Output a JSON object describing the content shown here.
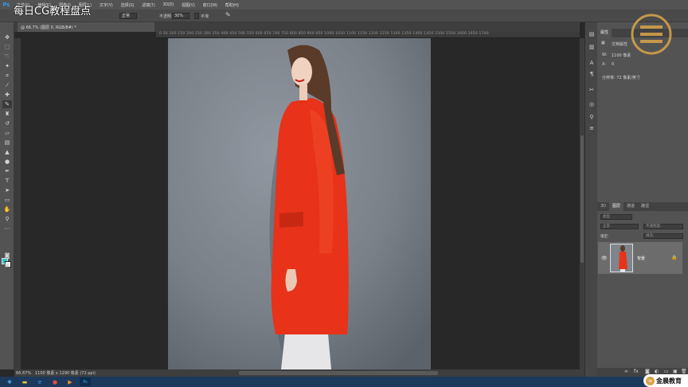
{
  "app": {
    "logo": "Ps",
    "accent_color": "#31a8ff"
  },
  "menu": [
    "文件(F)",
    "编辑(E)",
    "图像(I)",
    "图层(L)",
    "文字(Y)",
    "选择(S)",
    "滤镜(T)",
    "3D(D)",
    "视图(V)",
    "窗口(W)",
    "帮助(H)"
  ],
  "watermark": "每日CG教程盘点",
  "options_bar": {
    "opacity_label": "不透明",
    "opacity_value": "30%",
    "smooth_label": "平滑",
    "mode_value": "正常"
  },
  "document": {
    "tab_title": "@ 66.7% (图层 0, RGB/8#) *",
    "ruler_ticks": "0  50  100  150  200  250  300  350  400  450  500  550  600  650  700  750  800  850  900  950  1000  1050  1100  1150  1200  1250  1300  1350  1400  1450  1500  1550  1600  1650  1700",
    "zoom": "66.67%",
    "info": "1100 像素 x 1290 像素 (72 ppi)"
  },
  "tools": {
    "foreground_color": "#2ec4c4",
    "background_color": "#ffffff"
  },
  "properties_panel": {
    "title": "属性",
    "doc_properties": "文档属性",
    "width_label": "W:",
    "width_value": "1100 像素",
    "x_label": "X:",
    "x_value": "0",
    "resolution": "分辨率: 72 像素/英寸"
  },
  "layers_panel": {
    "tabs": [
      "3D",
      "图层",
      "通道",
      "路径"
    ],
    "active_tab": "图层",
    "kind_label": "类型",
    "blend_mode": "正常",
    "opacity_label": "不透明度:",
    "lock_label": "锁定:",
    "fill_label": "填充:",
    "layer": {
      "name": "背景",
      "visible": true,
      "locked": true
    }
  },
  "brand": {
    "badge_text": "金晨教育",
    "logo_color": "#d9a44a"
  },
  "taskbar_icons": [
    "start-icon",
    "folder-icon",
    "browser-icon",
    "chrome-icon",
    "media-icon",
    "ps-icon"
  ]
}
